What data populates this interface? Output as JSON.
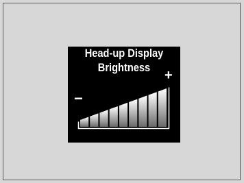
{
  "display": {
    "title_line1": "Head-up Display",
    "title_line2": "Brightness",
    "decrease_symbol": "−",
    "increase_symbol": "+"
  },
  "brightness": {
    "segments_total": 9,
    "segments_lit": 9,
    "level_fraction": 1.0
  },
  "colors": {
    "background": "#d7d7d7",
    "panel": "#000000",
    "text": "#ffffff",
    "segment_bottom": "#6a6a6a",
    "segment_top": "#ffffff"
  }
}
